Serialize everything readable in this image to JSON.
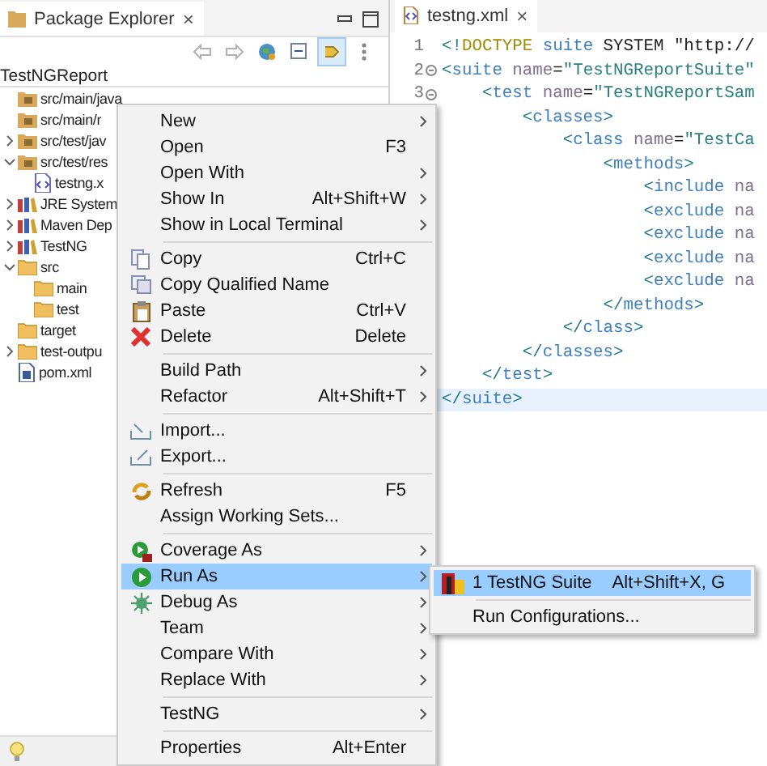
{
  "explorer": {
    "tab": {
      "title": "Package Explorer",
      "close": "×"
    },
    "toolbar": [
      {
        "kind": "back",
        "selected": false
      },
      {
        "kind": "forward",
        "selected": false
      },
      {
        "kind": "globe",
        "selected": false
      },
      {
        "kind": "collapse",
        "selected": false
      },
      {
        "kind": "link",
        "selected": true
      },
      {
        "kind": "more",
        "selected": false
      }
    ],
    "root": "TestNGReport",
    "tree": [
      {
        "label": "src/main/java",
        "kind": "package"
      },
      {
        "label": "src/main/r",
        "kind": "package"
      },
      {
        "label": "src/test/jav",
        "kind": "package",
        "expanded": false
      },
      {
        "label": "src/test/res",
        "kind": "package",
        "expanded": true,
        "children": [
          {
            "label": "testng.x",
            "kind": "xml"
          }
        ]
      },
      {
        "label": "JRE System",
        "kind": "library",
        "expanded": false
      },
      {
        "label": "Maven Dep",
        "kind": "library",
        "expanded": false
      },
      {
        "label": "TestNG",
        "kind": "library",
        "expanded": false
      },
      {
        "label": "src",
        "kind": "folder",
        "expanded": true,
        "children": [
          {
            "label": "main",
            "kind": "folder"
          },
          {
            "label": "test",
            "kind": "folder"
          }
        ]
      },
      {
        "label": "target",
        "kind": "folder"
      },
      {
        "label": "test-outpu",
        "kind": "folder",
        "expanded": false
      },
      {
        "label": "pom.xml",
        "kind": "maven"
      }
    ]
  },
  "editor": {
    "tab": {
      "title": "testng.xml",
      "close": "×"
    },
    "lines": [
      {
        "number": "1",
        "fold": false,
        "current": false,
        "tokens": [
          {
            "kind": "punct",
            "text": "<!"
          },
          {
            "kind": "doctype",
            "text": "DOCTYPE"
          },
          {
            "kind": "tag",
            "text": " suite"
          },
          {
            "kind": "plain",
            "text": " SYSTEM \"http://"
          }
        ]
      },
      {
        "number": "2",
        "fold": true,
        "current": false,
        "tokens": [
          {
            "kind": "punct",
            "text": "<"
          },
          {
            "kind": "tag",
            "text": "suite"
          },
          {
            "kind": "attr",
            "text": " name"
          },
          {
            "kind": "plain",
            "text": "="
          },
          {
            "kind": "value",
            "text": "\"TestNGReportSuite\""
          }
        ]
      },
      {
        "number": "3",
        "fold": true,
        "current": false,
        "tokens": [
          {
            "kind": "punct",
            "text": "    <"
          },
          {
            "kind": "tag",
            "text": "test"
          },
          {
            "kind": "attr",
            "text": " name"
          },
          {
            "kind": "plain",
            "text": "="
          },
          {
            "kind": "value",
            "text": "\"TestNGReportSam"
          }
        ]
      },
      {
        "current": false,
        "tokens": [
          {
            "kind": "punct",
            "text": "        <"
          },
          {
            "kind": "tag",
            "text": "classes"
          },
          {
            "kind": "punct",
            "text": ">"
          }
        ]
      },
      {
        "current": false,
        "tokens": [
          {
            "kind": "punct",
            "text": "            <"
          },
          {
            "kind": "tag",
            "text": "class"
          },
          {
            "kind": "attr",
            "text": " name"
          },
          {
            "kind": "plain",
            "text": "="
          },
          {
            "kind": "value",
            "text": "\"TestCa"
          }
        ]
      },
      {
        "current": false,
        "tokens": [
          {
            "kind": "punct",
            "text": "                <"
          },
          {
            "kind": "tag",
            "text": "methods"
          },
          {
            "kind": "punct",
            "text": ">"
          }
        ]
      },
      {
        "current": false,
        "tokens": [
          {
            "kind": "punct",
            "text": "                    <"
          },
          {
            "kind": "tag",
            "text": "include"
          },
          {
            "kind": "attr",
            "text": " na"
          }
        ]
      },
      {
        "current": false,
        "tokens": [
          {
            "kind": "punct",
            "text": "                    <"
          },
          {
            "kind": "tag",
            "text": "exclude"
          },
          {
            "kind": "attr",
            "text": " na"
          }
        ]
      },
      {
        "current": false,
        "tokens": [
          {
            "kind": "punct",
            "text": "                    <"
          },
          {
            "kind": "tag",
            "text": "exclude"
          },
          {
            "kind": "attr",
            "text": " na"
          }
        ]
      },
      {
        "current": false,
        "tokens": [
          {
            "kind": "punct",
            "text": "                    <"
          },
          {
            "kind": "tag",
            "text": "exclude"
          },
          {
            "kind": "attr",
            "text": " na"
          }
        ]
      },
      {
        "current": false,
        "tokens": [
          {
            "kind": "punct",
            "text": "                    <"
          },
          {
            "kind": "tag",
            "text": "exclude"
          },
          {
            "kind": "attr",
            "text": " na"
          }
        ]
      },
      {
        "current": false,
        "tokens": [
          {
            "kind": "punct",
            "text": "                </"
          },
          {
            "kind": "tag",
            "text": "methods"
          },
          {
            "kind": "punct",
            "text": ">"
          }
        ]
      },
      {
        "current": false,
        "tokens": [
          {
            "kind": "punct",
            "text": "            </"
          },
          {
            "kind": "tag",
            "text": "class"
          },
          {
            "kind": "punct",
            "text": ">"
          }
        ]
      },
      {
        "current": false,
        "tokens": [
          {
            "kind": "punct",
            "text": "        </"
          },
          {
            "kind": "tag",
            "text": "classes"
          },
          {
            "kind": "punct",
            "text": ">"
          }
        ]
      },
      {
        "current": false,
        "tokens": [
          {
            "kind": "punct",
            "text": "    </"
          },
          {
            "kind": "tag",
            "text": "test"
          },
          {
            "kind": "punct",
            "text": ">"
          }
        ]
      },
      {
        "current": true,
        "tokens": [
          {
            "kind": "punct",
            "text": "</"
          },
          {
            "kind": "tag",
            "text": "suite"
          },
          {
            "kind": "punct",
            "text": ">"
          }
        ]
      }
    ]
  },
  "context_menu": {
    "groups": [
      [
        {
          "label": "New",
          "submenu": true,
          "selected": false
        },
        {
          "label": "Open",
          "shortcut": "F3",
          "submenu": false,
          "selected": false
        },
        {
          "label": "Open With",
          "submenu": true,
          "selected": false
        },
        {
          "label": "Show In",
          "shortcut": "Alt+Shift+W",
          "submenu": true,
          "selected": false
        },
        {
          "label": "Show in Local Terminal",
          "submenu": true,
          "selected": false
        }
      ],
      [
        {
          "label": "Copy",
          "kind": "copy",
          "shortcut": "Ctrl+C",
          "submenu": false,
          "selected": false
        },
        {
          "label": "Copy Qualified Name",
          "kind": "copy-name",
          "submenu": false,
          "selected": false
        },
        {
          "label": "Paste",
          "kind": "paste",
          "shortcut": "Ctrl+V",
          "submenu": false,
          "selected": false
        },
        {
          "label": "Delete",
          "kind": "delete",
          "shortcut": "Delete",
          "submenu": false,
          "selected": false
        }
      ],
      [
        {
          "label": "Build Path",
          "submenu": true,
          "selected": false
        },
        {
          "label": "Refactor",
          "shortcut": "Alt+Shift+T",
          "submenu": true,
          "selected": false
        }
      ],
      [
        {
          "label": "Import...",
          "kind": "import",
          "submenu": false,
          "selected": false
        },
        {
          "label": "Export...",
          "kind": "export",
          "submenu": false,
          "selected": false
        }
      ],
      [
        {
          "label": "Refresh",
          "kind": "refresh",
          "shortcut": "F5",
          "submenu": false,
          "selected": false
        },
        {
          "label": "Assign Working Sets...",
          "submenu": false,
          "selected": false
        }
      ],
      [
        {
          "label": "Coverage As",
          "kind": "coverage",
          "submenu": true,
          "selected": false
        },
        {
          "label": "Run As",
          "kind": "run",
          "submenu": true,
          "selected": true
        },
        {
          "label": "Debug As",
          "kind": "debug",
          "submenu": true,
          "selected": false
        },
        {
          "label": "Team",
          "submenu": true,
          "selected": false
        },
        {
          "label": "Compare With",
          "submenu": true,
          "selected": false
        },
        {
          "label": "Replace With",
          "submenu": true,
          "selected": false
        }
      ],
      [
        {
          "label": "TestNG",
          "submenu": true,
          "selected": false
        }
      ],
      [
        {
          "label": "Properties",
          "shortcut": "Alt+Enter",
          "submenu": false,
          "selected": false
        }
      ]
    ]
  },
  "submenu": {
    "groups": [
      [
        {
          "label": "1 TestNG Suite",
          "kind": "testng",
          "shortcut": "Alt+Shift+X, G",
          "submenu": false,
          "selected": true
        }
      ],
      [
        {
          "label": "Run Configurations...",
          "submenu": false,
          "selected": false
        }
      ]
    ]
  },
  "status_bar": {
    "kind": "lightbulb"
  }
}
